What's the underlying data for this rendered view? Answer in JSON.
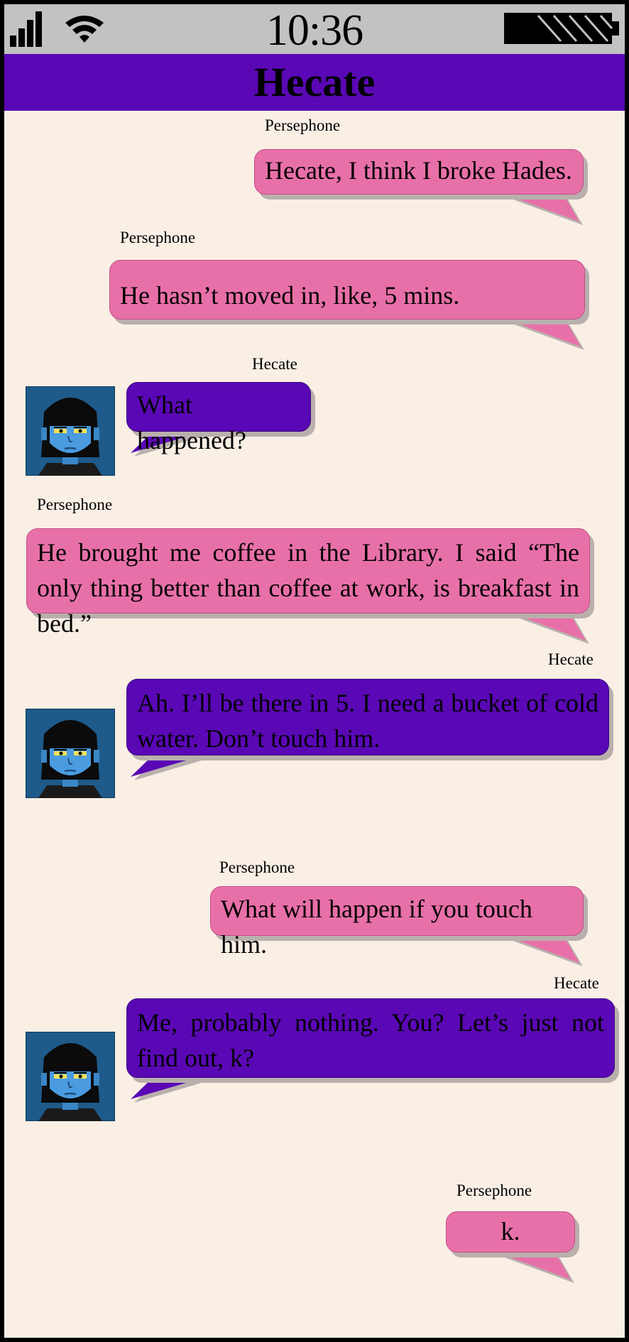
{
  "status_bar": {
    "time": "10:36",
    "signal_icon": "cellular-signal-icon",
    "wifi_icon": "wifi-icon",
    "battery_icon": "battery-icon"
  },
  "header": {
    "title": "Hecate"
  },
  "colors": {
    "header_bg": "#5a08b5",
    "outgoing_bubble": "#e870a8",
    "incoming_bubble": "#5a08b5",
    "screen_bg": "#f9efe5",
    "status_bar_bg": "#c2c2c2"
  },
  "messages": [
    {
      "sender": "Persephone",
      "text": "Hecate, I think I broke Hades."
    },
    {
      "sender": "Persephone",
      "text": "He hasn’t moved in, like, 5 mins."
    },
    {
      "sender": "Hecate",
      "text": "What happened?"
    },
    {
      "sender": "Persephone",
      "text": "He brought me coffee in the Library. I said “The only thing better than coffee at work, is breakfast in bed.”"
    },
    {
      "sender": "Hecate",
      "text": "Ah. I’ll be there in 5. I need a bucket of cold water. Don’t touch him."
    },
    {
      "sender": "Persephone",
      "text": "What will happen if you touch him."
    },
    {
      "sender": "Hecate",
      "text": "Me, probably nothing. You? Let’s just not find out, k?"
    },
    {
      "sender": "Persephone",
      "text": "k."
    }
  ]
}
